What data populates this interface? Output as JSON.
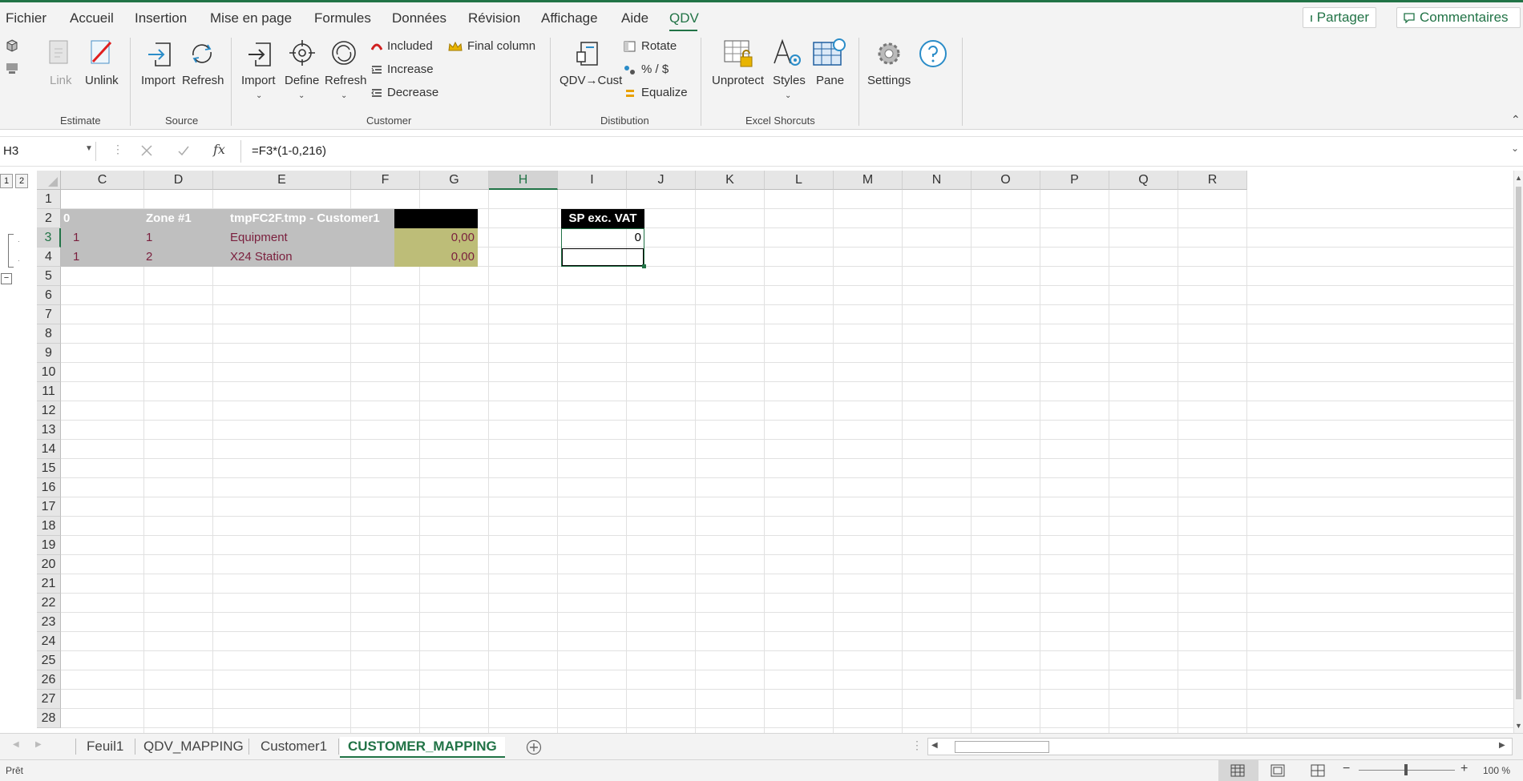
{
  "menu": {
    "items": [
      "Fichier",
      "Accueil",
      "Insertion",
      "Mise en page",
      "Formules",
      "Données",
      "Révision",
      "Affichage",
      "Aide",
      "QDV"
    ],
    "active": "QDV",
    "share_label": "Partager",
    "comments_label": "Commentaires"
  },
  "ribbon": {
    "estimate": {
      "link_label": "Link",
      "unlink_label": "Unlink",
      "group_label": "Estimate"
    },
    "source": {
      "import_label": "Import",
      "refresh_label": "Refresh",
      "group_label": "Source"
    },
    "customer": {
      "import_label": "Import",
      "define_label": "Define",
      "refresh_label": "Refresh",
      "included_label": "Included",
      "increase_label": "Increase",
      "decrease_label": "Decrease",
      "final_column_label": "Final column",
      "group_label": "Customer"
    },
    "distibution": {
      "qdv_cust_label": "QDV→Cust",
      "rotate_label": "Rotate",
      "percent_label": "% / $",
      "equalize_label": "Equalize",
      "group_label": "Distibution"
    },
    "shortcuts": {
      "unprotect_label": "Unprotect",
      "styles_label": "Styles",
      "pane_label": "Pane",
      "group_label": "Excel Shorcuts"
    },
    "settings_label": "Settings"
  },
  "formula_bar": {
    "name_box": "H3",
    "fx_label": "fx",
    "formula": "=F3*(1-0,216)"
  },
  "outline_levels": [
    "1",
    "2"
  ],
  "columns": [
    "C",
    "D",
    "E",
    "F",
    "G",
    "H",
    "I",
    "J",
    "K",
    "L",
    "M",
    "N",
    "O",
    "P",
    "Q",
    "R"
  ],
  "selected_column": "H",
  "rows": [
    "1",
    "2",
    "3",
    "4",
    "5",
    "6",
    "7",
    "8",
    "9",
    "10",
    "11",
    "12",
    "13",
    "14",
    "15",
    "16",
    "17",
    "18",
    "19",
    "20",
    "21",
    "22",
    "23",
    "24",
    "25",
    "26",
    "27",
    "28"
  ],
  "selected_row": "3",
  "cells": {
    "r2": {
      "c": "0",
      "d": "Zone #1",
      "e": "tmpFC2F.tmp - Customer1",
      "h": "SP exc. VAT"
    },
    "r3": {
      "c": "1",
      "d": "1",
      "e": "Equipment",
      "f": "0,00",
      "h": "0"
    },
    "r4": {
      "c": "1",
      "d": "2",
      "e": "X24 Station",
      "f": "0,00"
    }
  },
  "sheets": [
    "Feuil1",
    "QDV_MAPPING",
    "Customer1",
    "CUSTOMER_MAPPING"
  ],
  "active_sheet": "CUSTOMER_MAPPING",
  "status": {
    "ready": "Prêt",
    "zoom": "100 %"
  },
  "colors": {
    "accent": "#217346",
    "header_gray": "#bfbfbf",
    "olive": "#bdbd78",
    "maroon": "#7a1f3d",
    "black_header": "#000000"
  }
}
